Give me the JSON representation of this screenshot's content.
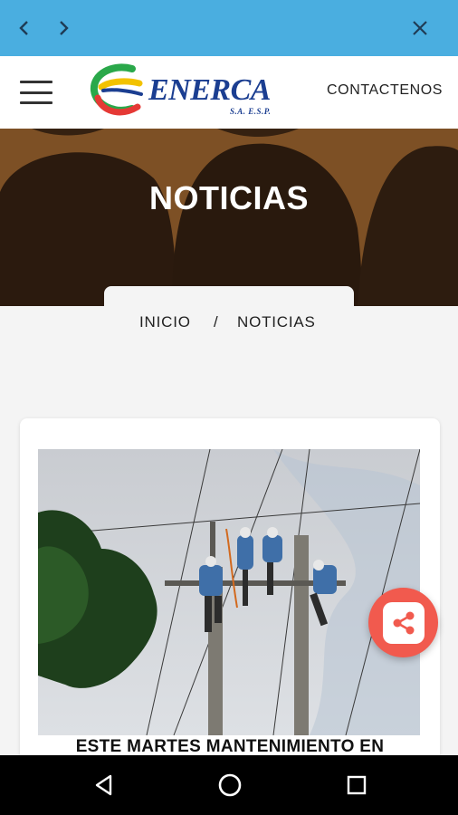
{
  "browser": {
    "back_icon": "chevron-left-icon",
    "forward_icon": "chevron-right-icon",
    "close_icon": "close-icon",
    "bar_color": "#4aaee0"
  },
  "header": {
    "menu_icon": "hamburger-menu-icon",
    "logo": {
      "name": "ENERCA",
      "subtitle": "S.A. E.S.P."
    },
    "contact_label": "CONTACTENOS"
  },
  "hero": {
    "title": "NOTICIAS"
  },
  "breadcrumb": {
    "home": "INICIO",
    "separator": "/",
    "current": "NOTICIAS"
  },
  "news": {
    "items": [
      {
        "title": "ESTE MARTES MANTENIMIENTO EN",
        "image_alt": "linemen working on power poles"
      }
    ]
  },
  "share": {
    "icon": "share-icon",
    "color": "#f15a4e"
  },
  "android_nav": {
    "back_icon": "triangle-back-icon",
    "home_icon": "circle-home-icon",
    "recent_icon": "square-recent-icon"
  }
}
